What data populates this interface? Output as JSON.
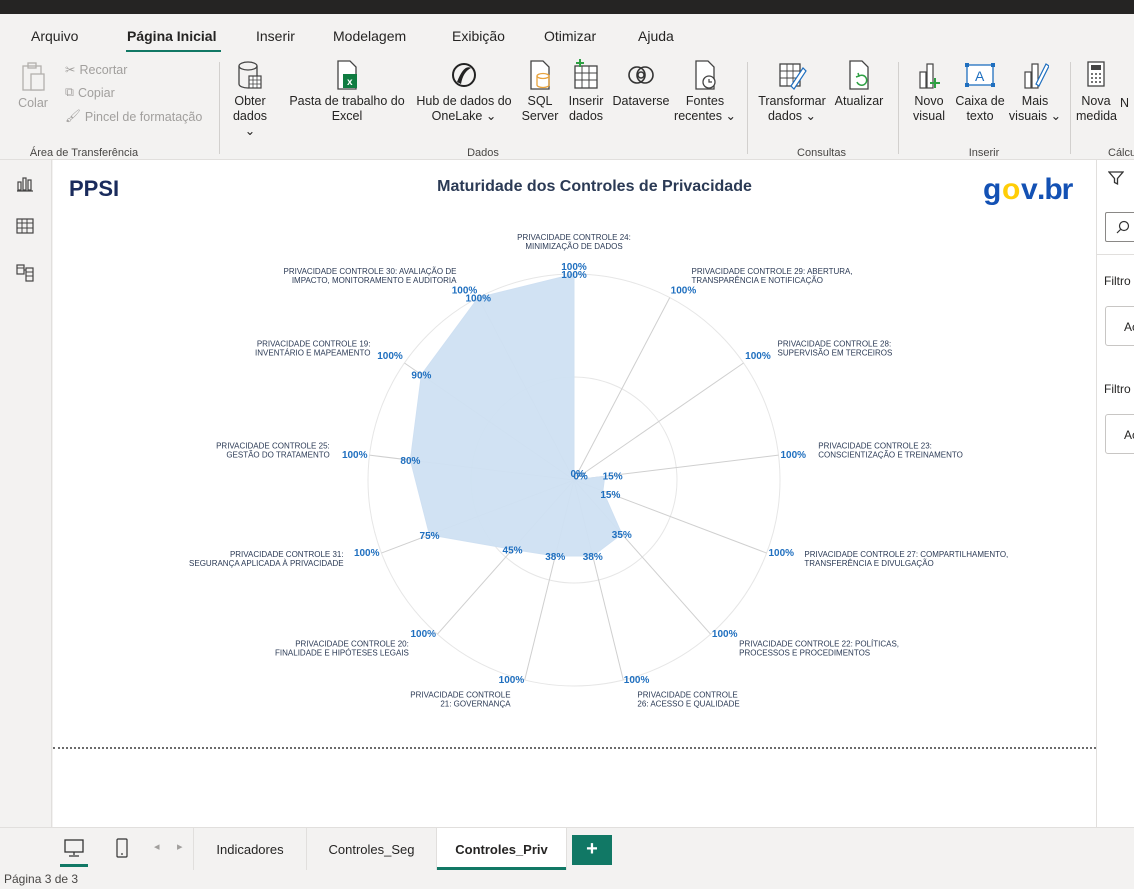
{
  "menu": {
    "items": [
      "Arquivo",
      "Página Inicial",
      "Inserir",
      "Modelagem",
      "Exibição",
      "Otimizar",
      "Ajuda"
    ],
    "active": "Página Inicial"
  },
  "ribbon": {
    "clipboard": {
      "paste": "Colar",
      "cut": "Recortar",
      "copy": "Copiar",
      "format_painter": "Pincel de formatação",
      "group": "Área de Transferência"
    },
    "data": {
      "get_data": [
        "Obter",
        "dados ⌄"
      ],
      "excel": [
        "Pasta de trabalho do",
        "Excel"
      ],
      "onelake": [
        "Hub de dados do",
        "OneLake ⌄"
      ],
      "sql": [
        "SQL",
        "Server"
      ],
      "enter_data": [
        "Inserir",
        "dados"
      ],
      "dataverse": "Dataverse",
      "recent": [
        "Fontes",
        "recentes ⌄"
      ],
      "group": "Dados"
    },
    "queries": {
      "transform": [
        "Transformar",
        "dados ⌄"
      ],
      "refresh": "Atualizar",
      "group": "Consultas"
    },
    "insert": {
      "new_visual": [
        "Novo",
        "visual"
      ],
      "text_box": [
        "Caixa de",
        "texto"
      ],
      "more_visuals": [
        "Mais",
        "visuais ⌄"
      ],
      "group": "Inserir"
    },
    "calc": {
      "new_measure": [
        "Nova",
        "medida"
      ],
      "next_cut": "N",
      "group": "Cálcu"
    }
  },
  "report": {
    "logo_left": "PPSI",
    "title": "Maturidade dos Controles de Privacidade",
    "logo_right": "gov.br"
  },
  "right_pane": {
    "filter_a": "Filtro",
    "filter_a_value": "Ac",
    "filter_b": "Filtro",
    "filter_b_value": "Ac"
  },
  "tabs": {
    "pages": [
      "Indicadores",
      "Controles_Seg",
      "Controles_Priv"
    ],
    "active": "Controles_Priv",
    "add": "+"
  },
  "status": {
    "page_info": "Página 3 de 3"
  },
  "colors": {
    "accent": "#117865",
    "radar_fill": "#cfe0f2",
    "value_label": "#1f6fbf",
    "govbr_blue": "#1351b4",
    "govbr_yellow": "#ffcd07"
  },
  "chart_data": {
    "type": "radar",
    "title": "Maturidade dos Controles de Privacidade",
    "rmax": 100,
    "axes": [
      {
        "label": [
          "PRIVACIDADE CONTROLE 24:",
          "MINIMIZAÇÃO DE DADOS"
        ],
        "actual": 100,
        "target": 100
      },
      {
        "label": [
          "PRIVACIDADE CONTROLE 29:  ABERTURA,",
          "TRANSPARÊNCIA E NOTIFICAÇÃO"
        ],
        "actual": 0,
        "target": 100
      },
      {
        "label": [
          "PRIVACIDADE CONTROLE 28:",
          "SUPERVISÃO EM TERCEIROS"
        ],
        "actual": 0,
        "target": 100
      },
      {
        "label": [
          "PRIVACIDADE CONTROLE 23:",
          "CONSCIENTIZAÇÃO E TREINAMENTO"
        ],
        "actual": 15,
        "target": 100
      },
      {
        "label": [
          "PRIVACIDADE CONTROLE 27: COMPARTILHAMENTO,",
          "TRANSFERÊNCIA E DIVULGAÇÃO"
        ],
        "actual": 15,
        "target": 100
      },
      {
        "label": [
          "PRIVACIDADE CONTROLE 22: POLÍTICAS,",
          "PROCESSOS E PROCEDIMENTOS"
        ],
        "actual": 35,
        "target": 100
      },
      {
        "label": [
          "PRIVACIDADE CONTROLE",
          "26: ACESSO E QUALIDADE"
        ],
        "actual": 38,
        "target": 100
      },
      {
        "label": [
          "PRIVACIDADE CONTROLE",
          "21: GOVERNANÇA"
        ],
        "actual": 38,
        "target": 100
      },
      {
        "label": [
          "PRIVACIDADE CONTROLE 20:",
          "FINALIDADE E HIPÓTESES LEGAIS"
        ],
        "actual": 45,
        "target": 100
      },
      {
        "label": [
          "PRIVACIDADE CONTROLE 31:",
          "SEGURANÇA APLICADA À PRIVACIDADE"
        ],
        "actual": 75,
        "target": 100
      },
      {
        "label": [
          "PRIVACIDADE CONTROLE 25:",
          "GESTÃO DO TRATAMENTO"
        ],
        "actual": 80,
        "target": 100
      },
      {
        "label": [
          "PRIVACIDADE CONTROLE 19:",
          "INVENTÁRIO E MAPEAMENTO"
        ],
        "actual": 90,
        "target": 100
      },
      {
        "label": [
          "PRIVACIDADE CONTROLE 30: AVALIAÇÃO DE",
          "IMPACTO, MONITORAMENTO E AUDITORIA"
        ],
        "actual": 100,
        "target": 100
      }
    ]
  }
}
